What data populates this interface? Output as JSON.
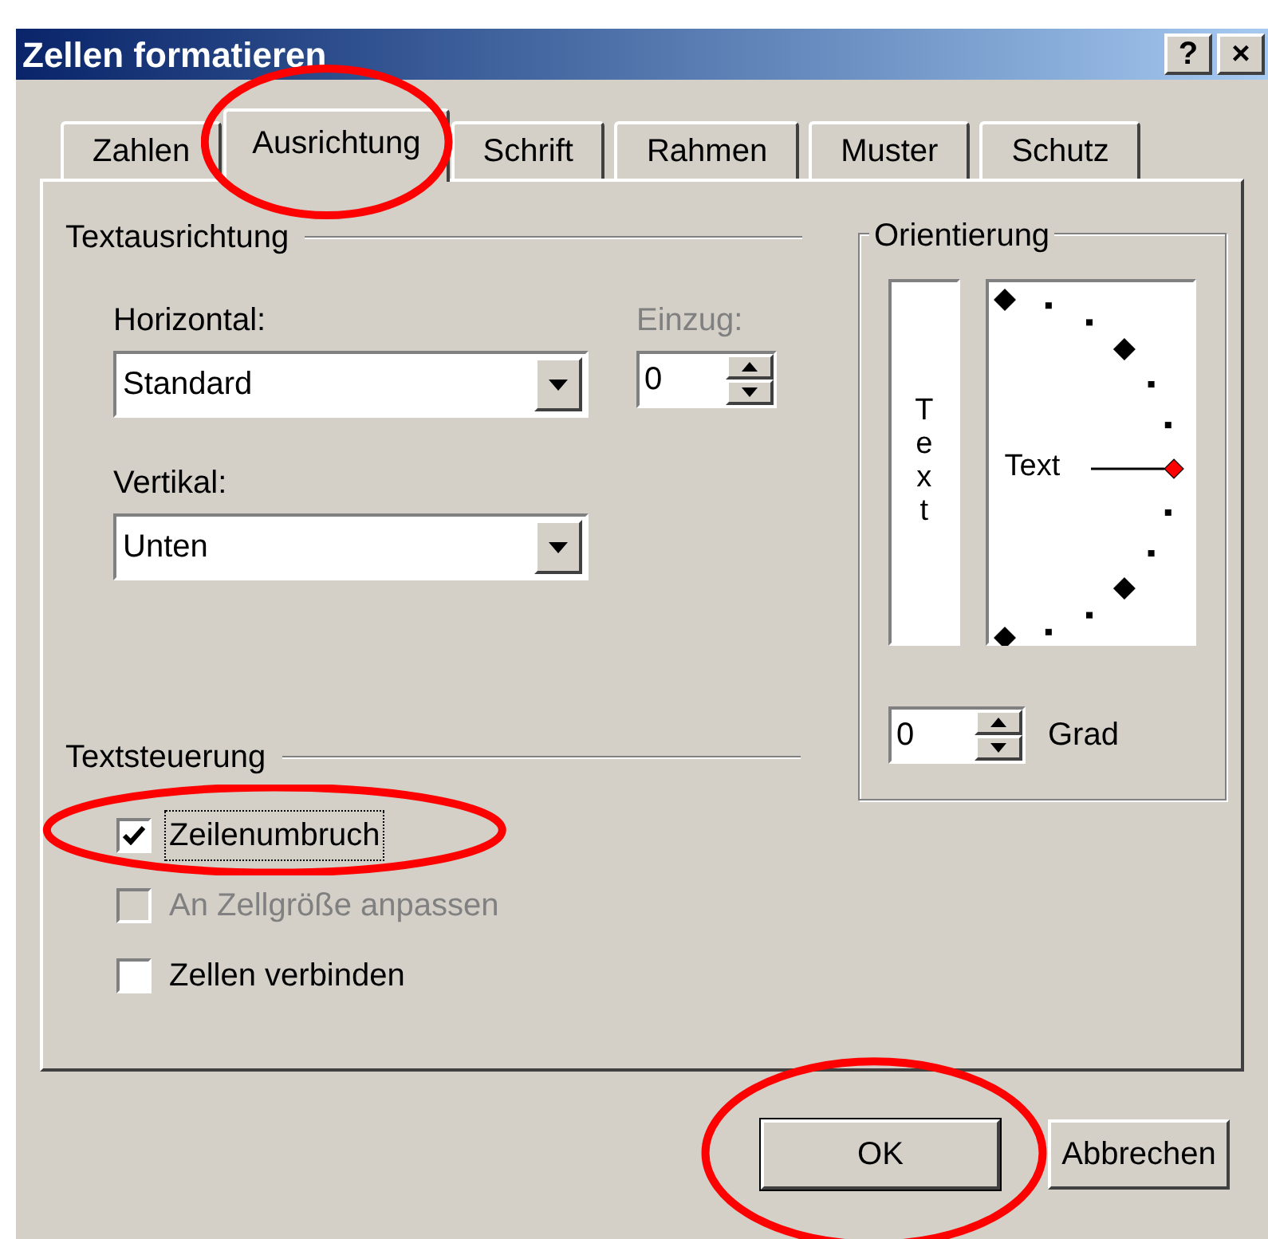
{
  "window": {
    "title": "Zellen formatieren",
    "buttons": [
      "?",
      "×"
    ]
  },
  "tabs": [
    {
      "label": "Zahlen",
      "selected": false,
      "highlighted": false
    },
    {
      "label": "Ausrichtung",
      "selected": true,
      "highlighted": true
    },
    {
      "label": "Schrift",
      "selected": false,
      "highlighted": false
    },
    {
      "label": "Rahmen",
      "selected": false,
      "highlighted": false
    },
    {
      "label": "Muster",
      "selected": false,
      "highlighted": false
    },
    {
      "label": "Schutz",
      "selected": false,
      "highlighted": false
    }
  ],
  "text_alignment": {
    "heading": "Textausrichtung",
    "horizontal": {
      "label": "Horizontal:",
      "value": "Standard"
    },
    "indent": {
      "label": "Einzug:",
      "value": "0",
      "disabled": true
    },
    "vertical": {
      "label": "Vertikal:",
      "value": "Unten"
    }
  },
  "text_control": {
    "heading": "Textsteuerung",
    "options": [
      {
        "label": "Zeilenumbruch",
        "checked": true,
        "disabled": false,
        "focused": true,
        "highlighted": true
      },
      {
        "label": "An Zellgröße anpassen",
        "checked": false,
        "disabled": true,
        "focused": false,
        "highlighted": false
      },
      {
        "label": "Zellen verbinden",
        "checked": false,
        "disabled": false,
        "focused": false,
        "highlighted": false
      }
    ]
  },
  "orientation": {
    "heading": "Orientierung",
    "vertical_sample": "Text",
    "dial_sample": "Text",
    "degrees": {
      "value": "0",
      "label": "Grad"
    }
  },
  "buttons": [
    {
      "label": "OK",
      "default": true,
      "highlighted": true
    },
    {
      "label": "Abbrechen",
      "default": false,
      "highlighted": false
    }
  ]
}
